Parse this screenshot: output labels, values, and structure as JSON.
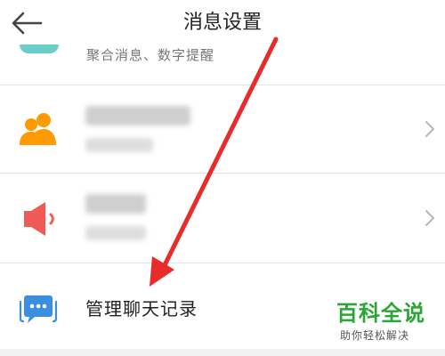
{
  "header": {
    "title": "消息设置"
  },
  "rows": [
    {
      "subtext": "聚合消息、数字提醒",
      "icon": "teal-icon",
      "partial": true
    },
    {
      "icon": "contacts-icon",
      "blurred": true,
      "icon_color": "#ff9a00"
    },
    {
      "icon": "speaker-icon",
      "blurred": true,
      "icon_color": "#ef5a57"
    },
    {
      "label": "管理聊天记录",
      "icon": "chat-bubble-icon",
      "icon_color": "#3c8fe0"
    }
  ],
  "watermark": {
    "main": "百科全说",
    "sub": "助你轻松解决"
  },
  "annotation": {
    "icon": "red-arrow-icon",
    "color": "#e82b2b"
  }
}
